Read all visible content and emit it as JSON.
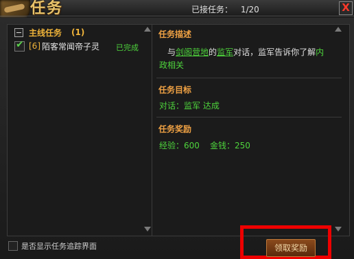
{
  "window": {
    "title": "任务",
    "accepted_label": "已接任务：",
    "accepted_count": "1/20",
    "close_glyph": "X"
  },
  "quest_list": {
    "category": {
      "label": "主线任务",
      "count": "(1)"
    },
    "items": [
      {
        "level": "[6]",
        "name": "陌客常闻帝子灵",
        "status": "已完成",
        "checked": true
      }
    ]
  },
  "details": {
    "description": {
      "heading": "任务描述",
      "parts": [
        {
          "text": "与",
          "style": "plain"
        },
        {
          "text": "剑阁营地",
          "style": "link"
        },
        {
          "text": "的",
          "style": "plain"
        },
        {
          "text": "监军",
          "style": "link"
        },
        {
          "text": "对话，监军告诉你了解",
          "style": "plain"
        },
        {
          "text": "内政相关",
          "style": "highlight"
        }
      ]
    },
    "objective": {
      "heading": "任务目标",
      "text": "对话：监军  达成"
    },
    "reward": {
      "heading": "任务奖励",
      "exp": "经验：600",
      "money": "金钱：250"
    }
  },
  "footer": {
    "tracking_label": "是否显示任务追踪界面",
    "tracking_checked": false,
    "claim_button": "领取奖励"
  },
  "colors": {
    "accent_gold": "#f0b43a",
    "accent_green": "#4ed43c",
    "highlight_red": "#ee0000"
  }
}
